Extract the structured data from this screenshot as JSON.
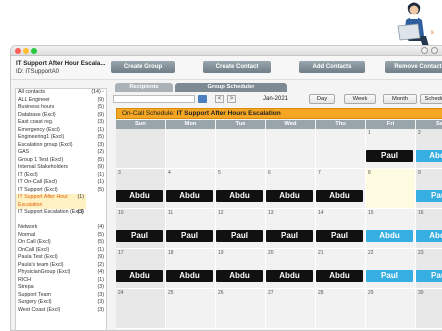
{
  "header": {
    "title": "IT Support After Hour Escala...",
    "id_text": "ID: ITSupportA0"
  },
  "toolbar": {
    "create_group": "Create Group",
    "create_contact": "Create Contact",
    "add_contacts": "Add Contacts",
    "fourth_button": "Remove Contact"
  },
  "sidebar": {
    "items": [
      {
        "label": "All contacts",
        "count": "(14) -"
      },
      {
        "label": "ALL Engineer",
        "count": "(9)"
      },
      {
        "label": "Business hours",
        "count": "(5)"
      },
      {
        "label": "Database (Excl)",
        "count": "(9)"
      },
      {
        "label": "East coast reg.",
        "count": "(3)"
      },
      {
        "label": "Emergency (Excl)",
        "count": "(1)"
      },
      {
        "label": "Engineering1 (Excl)",
        "count": "(5)"
      },
      {
        "label": "Escalation group (Excl)",
        "count": "(3)"
      },
      {
        "label": "GAS",
        "count": "(2)"
      },
      {
        "label": "Group 1 Test (Excl)",
        "count": "(5)"
      },
      {
        "label": "Internal Stakeholders",
        "count": "(9)"
      },
      {
        "label": "IT (Excl)",
        "count": "(1)"
      },
      {
        "label": "IT On-Call (Excl)",
        "count": "(1)"
      },
      {
        "label": "IT Support (Excl)",
        "count": "(5)"
      },
      {
        "label": "IT Support After Hour Escalation",
        "count": "(1)"
      },
      {
        "label": "IT Support Escalation (Excl)",
        "count": "(3)"
      },
      {
        "label": "Network",
        "count": "(4)"
      },
      {
        "label": "Normal",
        "count": "(5)"
      },
      {
        "label": "On Call (Excl)",
        "count": "(5)"
      },
      {
        "label": "OnCall (Excl)",
        "count": "(1)"
      },
      {
        "label": "Paula Test (Excl)",
        "count": "(9)"
      },
      {
        "label": "Paula's team (Excl)",
        "count": "(2)"
      },
      {
        "label": "PhysicianGroup (Excl)",
        "count": "(4)"
      },
      {
        "label": "RICH",
        "count": "(1)"
      },
      {
        "label": "Strepa",
        "count": "(3)"
      },
      {
        "label": "Support Team",
        "count": "(3)"
      },
      {
        "label": "Surgery (Excl)",
        "count": "(3)"
      },
      {
        "label": "West Coast (Excl)",
        "count": "(3)"
      }
    ]
  },
  "tabs": [
    "Recipients",
    "Group Scheduler"
  ],
  "nav": {
    "month_label": "Jan-2021",
    "prev": "<",
    "next": ">",
    "views": [
      "Day",
      "Week",
      "Month",
      "Schedules"
    ]
  },
  "banner": {
    "prefix": "On-Call Schedule: ",
    "name": "IT Support After Hours Escalation"
  },
  "calendar": {
    "days": [
      "Sun",
      "Mon",
      "Tue",
      "Wed",
      "Thu",
      "Fri",
      "Sat"
    ],
    "weeks": [
      [
        null,
        null,
        null,
        null,
        null,
        "1",
        "2"
      ],
      [
        "3",
        "4",
        "5",
        "6",
        "7",
        "8",
        "9"
      ],
      [
        "10",
        "11",
        "12",
        "13",
        "14",
        "15",
        "16"
      ],
      [
        "17",
        "18",
        "19",
        "20",
        "21",
        "22",
        "23"
      ],
      [
        "24",
        "25",
        "26",
        "27",
        "28",
        "29",
        "30"
      ]
    ],
    "events": [
      {
        "week": 0,
        "day": 5,
        "name": "Paul",
        "color": "black"
      },
      {
        "week": 0,
        "day": 6,
        "name": "Abdu",
        "color": "blue"
      },
      {
        "week": 0,
        "day": 7,
        "name": "Abdu",
        "color": "blue"
      },
      {
        "week": 1,
        "day": 0,
        "name": "Abdu",
        "color": "black"
      },
      {
        "week": 1,
        "day": 1,
        "name": "Abdu",
        "color": "black"
      },
      {
        "week": 1,
        "day": 2,
        "name": "Abdu",
        "color": "black"
      },
      {
        "week": 1,
        "day": 3,
        "name": "Abdu",
        "color": "black"
      },
      {
        "week": 1,
        "day": 4,
        "name": "Abdu",
        "color": "black"
      },
      {
        "week": 1,
        "day": 6,
        "name": "Paul",
        "color": "blue"
      },
      {
        "week": 1,
        "day": 7,
        "name": "Paul",
        "color": "blue"
      },
      {
        "week": 2,
        "day": 0,
        "name": "Paul",
        "color": "black"
      },
      {
        "week": 2,
        "day": 1,
        "name": "Paul",
        "color": "black"
      },
      {
        "week": 2,
        "day": 2,
        "name": "Paul",
        "color": "black"
      },
      {
        "week": 2,
        "day": 3,
        "name": "Paul",
        "color": "black"
      },
      {
        "week": 2,
        "day": 4,
        "name": "Paul",
        "color": "black"
      },
      {
        "week": 2,
        "day": 5,
        "name": "Abdu",
        "color": "blue"
      },
      {
        "week": 2,
        "day": 6,
        "name": "Abdu",
        "color": "blue"
      },
      {
        "week": 2,
        "day": 7,
        "name": "Abdu",
        "color": "blue"
      },
      {
        "week": 3,
        "day": 0,
        "name": "Abdu",
        "color": "black"
      },
      {
        "week": 3,
        "day": 1,
        "name": "Abdu",
        "color": "black"
      },
      {
        "week": 3,
        "day": 2,
        "name": "Abdu",
        "color": "black"
      },
      {
        "week": 3,
        "day": 3,
        "name": "Abdu",
        "color": "black"
      },
      {
        "week": 3,
        "day": 4,
        "name": "Abdu",
        "color": "black"
      },
      {
        "week": 3,
        "day": 5,
        "name": "Paul",
        "color": "blue"
      },
      {
        "week": 3,
        "day": 6,
        "name": "Paul",
        "color": "blue"
      },
      {
        "week": 3,
        "day": 7,
        "name": "Paul",
        "color": "blue"
      }
    ]
  },
  "colors": {
    "banner": "#f5a623",
    "event_black": "#111111",
    "event_blue": "#36aee2",
    "selected_text": "#e2600d",
    "toolbar_button": "#7d8a93"
  }
}
